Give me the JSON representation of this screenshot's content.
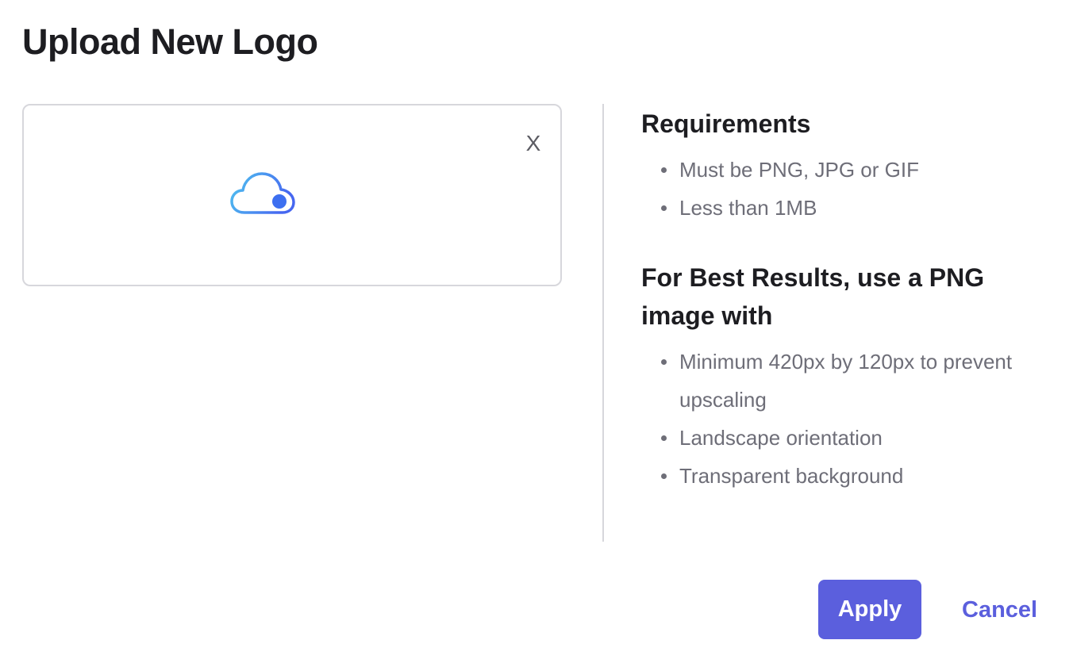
{
  "dialog": {
    "title": "Upload New Logo"
  },
  "upload": {
    "remove_label": "X",
    "icon": "cloud-upload-icon",
    "icon_gradient": [
      "#4fc3ef",
      "#4667f0"
    ],
    "dot_color": "#3d6ff0"
  },
  "requirements": {
    "heading": "Requirements",
    "items": [
      "Must be PNG, JPG or GIF",
      "Less than 1MB"
    ]
  },
  "best_results": {
    "heading": "For Best Results, use a PNG image with",
    "items": [
      "Minimum 420px by 120px to prevent upscaling",
      "Landscape orientation",
      "Transparent background"
    ]
  },
  "footer": {
    "apply_label": "Apply",
    "cancel_label": "Cancel"
  },
  "colors": {
    "accent": "#5b5fdd",
    "text": "#1d1d21",
    "muted_text": "#6e6e78",
    "border": "#d7d7dc"
  }
}
